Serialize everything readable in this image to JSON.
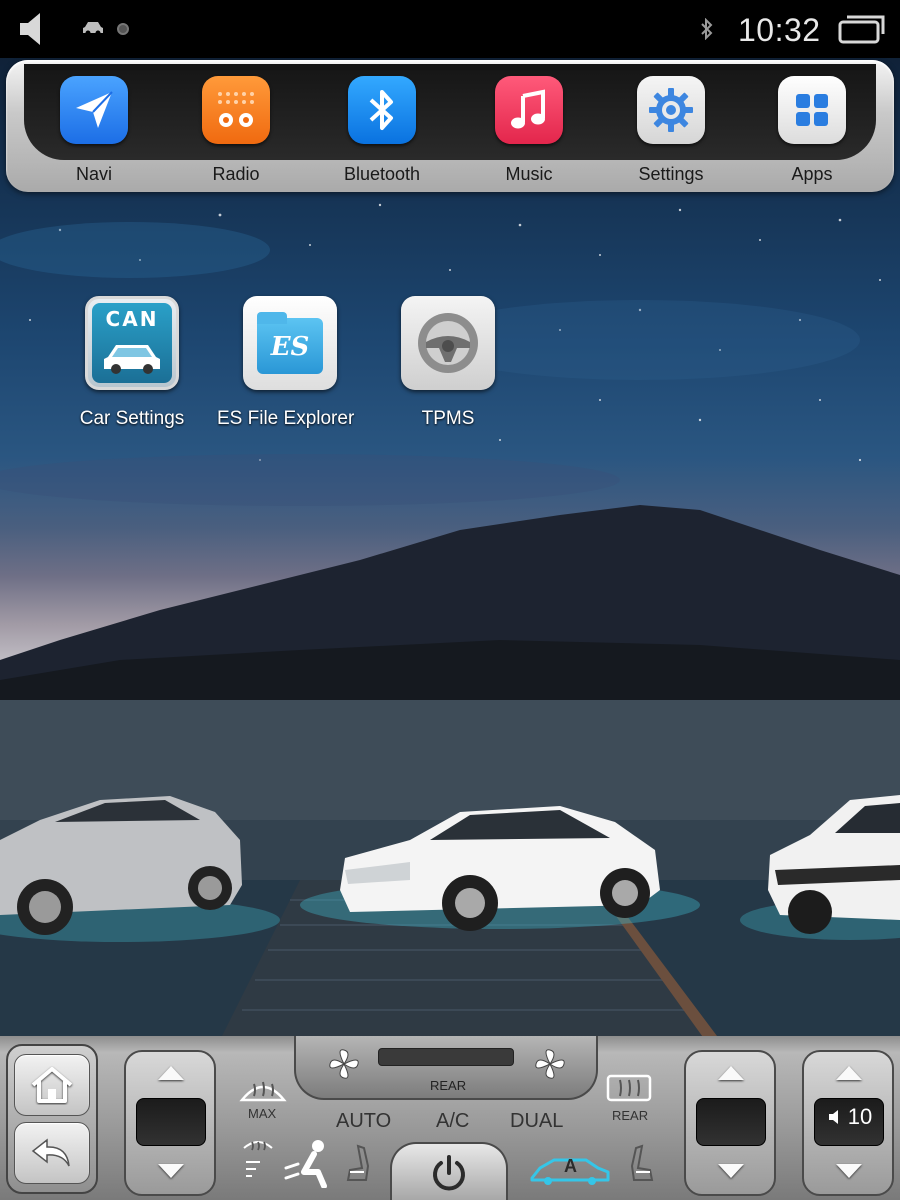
{
  "status_bar": {
    "time": "10:32",
    "icons": [
      "volume-icon",
      "car-icon",
      "record-dot-icon",
      "bluetooth-icon",
      "recent-apps-icon"
    ]
  },
  "dock": {
    "items": [
      {
        "label": "Navi",
        "icon": "navigation-arrow-icon"
      },
      {
        "label": "Radio",
        "icon": "radio-icon"
      },
      {
        "label": "Bluetooth",
        "icon": "bluetooth-icon"
      },
      {
        "label": "Music",
        "icon": "music-note-icon"
      },
      {
        "label": "Settings",
        "icon": "gear-icon"
      },
      {
        "label": "Apps",
        "icon": "grid-icon"
      }
    ]
  },
  "desktop": {
    "apps": [
      {
        "label": "Car Settings",
        "icon": "can-car-icon",
        "icon_text": "CAN"
      },
      {
        "label": "ES File Explorer",
        "icon": "es-folder-icon",
        "icon_text": "ES"
      },
      {
        "label": "TPMS",
        "icon": "steering-wheel-icon"
      }
    ]
  },
  "climate": {
    "rear_label": "REAR",
    "max_label": "MAX",
    "rear_defrost_label": "REAR",
    "auto_label": "AUTO",
    "ac_label": "A/C",
    "dual_label": "DUAL",
    "recirc_label": "A",
    "icons": [
      "fan-icon",
      "front-defrost-icon",
      "rear-defrost-icon",
      "seat-heat-icon",
      "airflow-person-icon",
      "power-icon",
      "recirculation-car-icon"
    ]
  },
  "volume": {
    "value": "10"
  },
  "colors": {
    "navi": "#1c6ee6",
    "radio": "#f06a10",
    "bluetooth": "#0a72e0",
    "music": "#e3264c"
  }
}
